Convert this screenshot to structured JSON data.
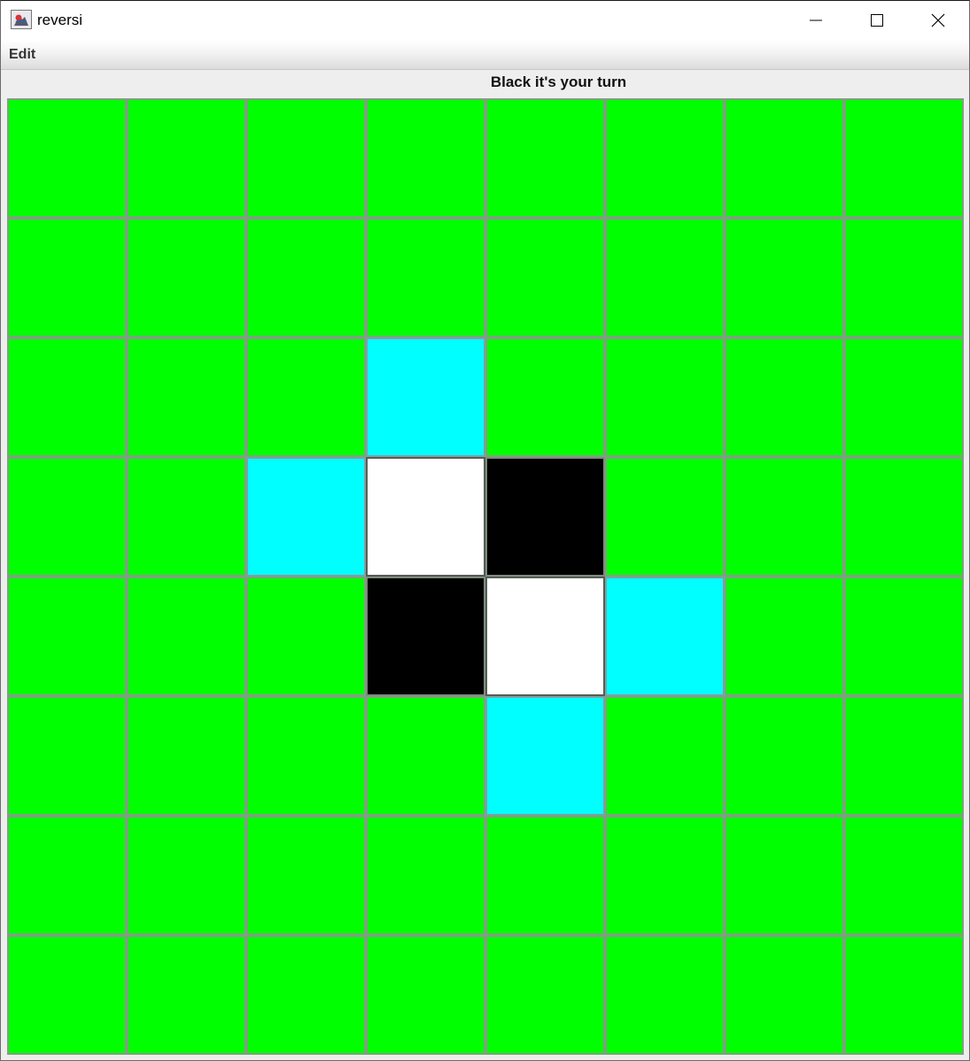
{
  "window": {
    "title": "reversi",
    "icon": "java-app-icon"
  },
  "menu": {
    "items": [
      {
        "label": "Edit"
      }
    ]
  },
  "status": {
    "text": "Black it's your turn"
  },
  "colors": {
    "empty": "#00ff00",
    "possible_move": "#00ffff",
    "white": "#ffffff",
    "black": "#000000"
  },
  "board": {
    "size": 8,
    "rows": [
      [
        "empty",
        "empty",
        "empty",
        "empty",
        "empty",
        "empty",
        "empty",
        "empty"
      ],
      [
        "empty",
        "empty",
        "empty",
        "empty",
        "empty",
        "empty",
        "empty",
        "empty"
      ],
      [
        "empty",
        "empty",
        "empty",
        "possible",
        "empty",
        "empty",
        "empty",
        "empty"
      ],
      [
        "empty",
        "empty",
        "possible",
        "white",
        "black",
        "empty",
        "empty",
        "empty"
      ],
      [
        "empty",
        "empty",
        "empty",
        "black",
        "white",
        "possible",
        "empty",
        "empty"
      ],
      [
        "empty",
        "empty",
        "empty",
        "empty",
        "possible",
        "empty",
        "empty",
        "empty"
      ],
      [
        "empty",
        "empty",
        "empty",
        "empty",
        "empty",
        "empty",
        "empty",
        "empty"
      ],
      [
        "empty",
        "empty",
        "empty",
        "empty",
        "empty",
        "empty",
        "empty",
        "empty"
      ]
    ]
  }
}
